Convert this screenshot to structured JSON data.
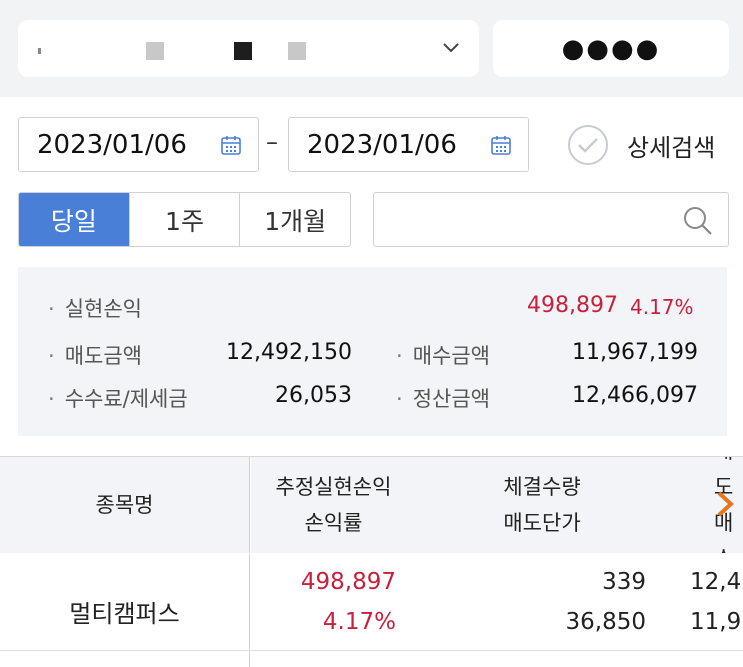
{
  "account": {
    "name_masked": ""
  },
  "password": {
    "masked": "●●●●"
  },
  "date_range": {
    "start": "2023/01/06",
    "separator": "–",
    "end": "2023/01/06"
  },
  "detail_search": {
    "label": "상세검색",
    "checked": false
  },
  "period_tabs": [
    {
      "label": "당일",
      "active": true
    },
    {
      "label": "1주",
      "active": false
    },
    {
      "label": "1개월",
      "active": false
    }
  ],
  "search": {
    "value": "",
    "placeholder": ""
  },
  "summary": {
    "realized_pnl": {
      "label": "실현손익",
      "value": "498,897",
      "rate": "4.17%"
    },
    "sell_amount": {
      "label": "매도금액",
      "value": "12,492,150"
    },
    "buy_amount": {
      "label": "매수금액",
      "value": "11,967,199"
    },
    "fees_taxes": {
      "label": "수수료/제세금",
      "value": "26,053"
    },
    "settlement_amount": {
      "label": "정산금액",
      "value": "12,466,097"
    }
  },
  "table": {
    "headers": {
      "col1": "종목명",
      "col2_line1": "추정실현손익",
      "col2_line2": "손익률",
      "col3_line1": "체결수량",
      "col3_line2": "매도단가",
      "col4_line1": "매도",
      "col4_line2": "매수"
    },
    "rows": [
      {
        "name": "멀티캠퍼스",
        "pnl": "498,897",
        "rate": "4.17%",
        "qty": "339",
        "sell_price": "36,850",
        "col4_line1": "12,4",
        "col4_line2": "11,9"
      }
    ]
  },
  "colors": {
    "accent": "#4a7fd7",
    "profit_red": "#c8203c",
    "panel_bg": "#f3f4f7",
    "scroll_arrow": "#e8761e"
  }
}
